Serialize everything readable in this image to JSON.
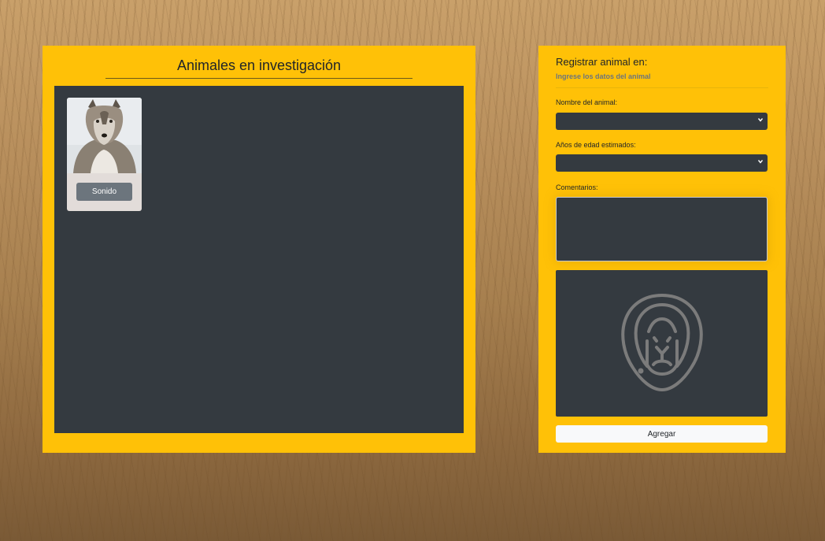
{
  "gallery": {
    "title": "Animales en investigación",
    "animals": [
      {
        "image": "wolf-photo",
        "sound_label": "Sonido"
      }
    ]
  },
  "form": {
    "title": "Registrar animal en:",
    "subtitle": "Ingrese los datos del animal",
    "name_label": "Nombre del animal:",
    "name_value": "",
    "age_label": "Años de edad estimados:",
    "age_value": "",
    "comments_label": "Comentarios:",
    "comments_value": "",
    "preview_icon": "lion-icon",
    "submit_label": "Agregar"
  },
  "colors": {
    "panel": "#ffc107",
    "dark": "#343a40",
    "button_gray": "#6c757d"
  }
}
